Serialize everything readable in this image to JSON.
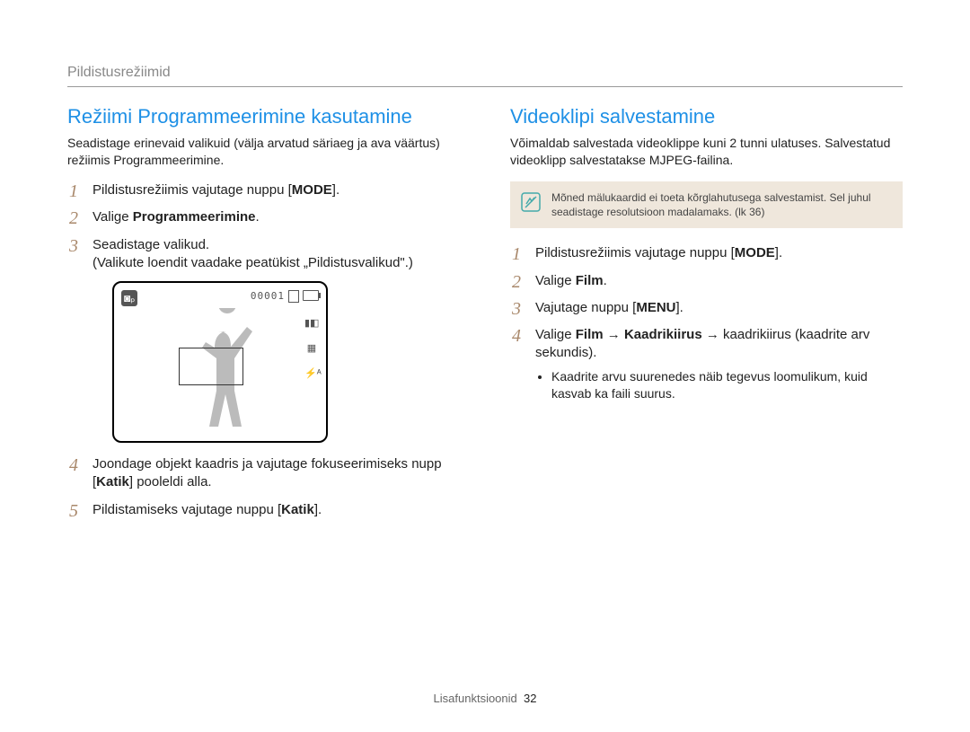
{
  "breadcrumb": "Pildistusrežiimid",
  "left": {
    "title": "Režiimi Programmeerimine kasutamine",
    "intro": "Seadistage erinevaid valikuid (välja arvatud säriaeg ja ava väärtus) režiimis Programmeerimine.",
    "step1_prefix": "Pildistusrežiimis vajutage nuppu [",
    "step1_button": "MODE",
    "step1_suffix": "].",
    "step2_prefix": "Valige ",
    "step2_bold": "Programmeerimine",
    "step2_suffix": ".",
    "step3_a": "Seadistage valikud.",
    "step3_b": "(Valikute loendit vaadake peatükist „Pildistusvalikud\".)",
    "screen": {
      "counter": "00001"
    },
    "step4_prefix": "Joondage objekt kaadris ja vajutage fokuseerimiseks nupp [",
    "step4_bold": "Katik",
    "step4_suffix": "] pooleldi alla.",
    "step5_prefix": "Pildistamiseks vajutage nuppu [",
    "step5_bold": "Katik",
    "step5_suffix": "]."
  },
  "right": {
    "title": "Videoklipi salvestamine",
    "intro": "Võimaldab salvestada videoklippe kuni 2 tunni ulatuses. Salvestatud videoklipp salvestatakse MJPEG-failina.",
    "note": "Mõned mälukaardid ei toeta kõrglahutusega salvestamist. Sel juhul seadistage resolutsioon madalamaks. (lk 36)",
    "step1_prefix": "Pildistusrežiimis vajutage nuppu [",
    "step1_button": "MODE",
    "step1_suffix": "].",
    "step2_prefix": "Valige ",
    "step2_bold": "Film",
    "step2_suffix": ".",
    "step3_prefix": "Vajutage nuppu [",
    "step3_bold": "MENU",
    "step3_suffix": "].",
    "step4_prefix": "Valige ",
    "step4_b1": "Film",
    "step4_arrow": " → ",
    "step4_b2": "Kaadrikiirus",
    "step4_suffix": " → kaadrikiirus (kaadrite arv sekundis).",
    "step4_sub": "Kaadrite arvu suurenedes näib tegevus loomulikum, kuid kasvab ka faili suurus."
  },
  "footer": {
    "label": "Lisafunktsioonid",
    "page": "32"
  }
}
